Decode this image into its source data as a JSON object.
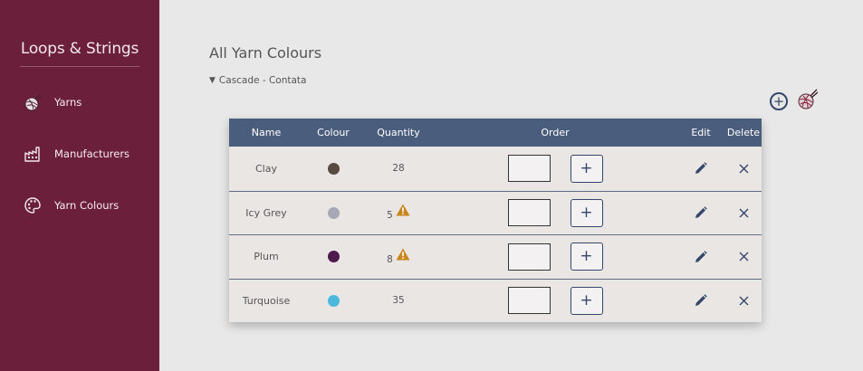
{
  "sidebar": {
    "brand": "Loops & Strings",
    "items": [
      {
        "label": "Yarns",
        "icon": "yarn-ball-icon"
      },
      {
        "label": "Manufacturers",
        "icon": "factory-icon"
      },
      {
        "label": "Yarn Colours",
        "icon": "palette-icon"
      }
    ]
  },
  "main": {
    "title": "All Yarn Colours",
    "group_label": "Cascade - Contata",
    "actions": {
      "add_icon": "circle-plus-icon",
      "yarn_icon": "yarn-ball-icon"
    }
  },
  "table": {
    "headers": {
      "name": "Name",
      "colour": "Colour",
      "quantity": "Quantity",
      "order": "Order",
      "edit": "Edit",
      "delete": "Delete"
    },
    "rows": [
      {
        "name": "Clay",
        "colour": "#5a4a44",
        "quantity": "28",
        "low_stock": false,
        "order_value": ""
      },
      {
        "name": "Icy Grey",
        "colour": "#a7a8b3",
        "quantity": "5",
        "low_stock": true,
        "order_value": ""
      },
      {
        "name": "Plum",
        "colour": "#4f1a4e",
        "quantity": "8",
        "low_stock": true,
        "order_value": ""
      },
      {
        "name": "Turquoise",
        "colour": "#4bb8dc",
        "quantity": "35",
        "low_stock": false,
        "order_value": ""
      }
    ],
    "plus_label": "+"
  },
  "colors": {
    "sidebar_bg": "#6b1f3a",
    "header_bg": "#4b5d7c",
    "accent": "#34476a",
    "warning": "#c8861e"
  }
}
